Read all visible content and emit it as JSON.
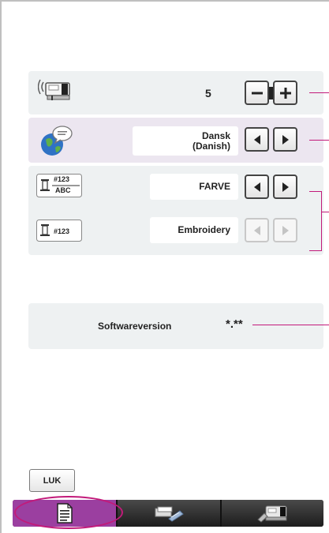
{
  "volume": {
    "icon": "sewing-machine-sound-icon",
    "value": "5",
    "minus_symbol": "−",
    "plus_symbol": "+"
  },
  "language": {
    "icon": "globe-speech-icon",
    "value_line1": "Dansk",
    "value_line2": "(Danish)",
    "prev_symbol": "◀",
    "next_symbol": "▶"
  },
  "thread_display": {
    "icon": "thread-number-abc-icon",
    "icon_top": "#123",
    "icon_bottom": "ABC",
    "value": "FARVE",
    "prev_symbol": "◀",
    "next_symbol": "▶"
  },
  "thread_number": {
    "icon": "thread-number-icon",
    "icon_text": "#123",
    "value": "Embroidery",
    "prev_symbol": "◀",
    "next_symbol": "▶"
  },
  "software": {
    "label": "Softwareversion",
    "value": "*.**"
  },
  "close_button": {
    "label": "LUK"
  },
  "tabs": [
    {
      "icon": "document-settings-icon",
      "active": true
    },
    {
      "icon": "embroidery-hoop-icon",
      "active": false
    },
    {
      "icon": "machine-settings-icon",
      "active": false
    }
  ],
  "colors": {
    "callout": "#c21a7a",
    "active_tab": "#9b3fa0",
    "panel": "#eef1f2",
    "panel_language": "#ece6f0"
  }
}
